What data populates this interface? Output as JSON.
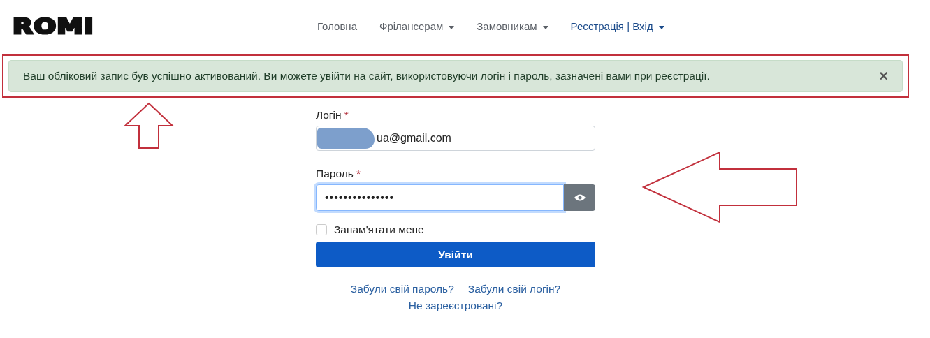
{
  "logo": "ROMI",
  "nav": [
    {
      "label": "Головна",
      "dropdown": false,
      "kind": "plain"
    },
    {
      "label": "Фрілансерам",
      "dropdown": true,
      "kind": "plain"
    },
    {
      "label": "Замовникам",
      "dropdown": true,
      "kind": "plain"
    },
    {
      "label": "Реєстрація | Вхід",
      "dropdown": true,
      "kind": "accent"
    }
  ],
  "alert": {
    "message": "Ваш обліковий запис був успішно активований. Ви можете увійти на сайт, використовуючи логін і пароль, зазначені вами при реєстрації.",
    "close": "×"
  },
  "form": {
    "login": {
      "label": "Логін",
      "required": "*",
      "value": "ua@gmail.com",
      "redacted": true
    },
    "password": {
      "label": "Пароль",
      "required": "*",
      "value": "•••••••••••••••",
      "focused": true
    },
    "remember": {
      "label": "Запам'ятати мене",
      "checked": false
    },
    "submit": "Увійти",
    "links": [
      {
        "label": "Забули свій пароль?"
      },
      {
        "label": "Забули свій логін?"
      },
      {
        "label": "Не зареєстровані?"
      }
    ]
  },
  "annotations": [
    {
      "kind": "up-arrow"
    },
    {
      "kind": "left-arrow"
    }
  ]
}
